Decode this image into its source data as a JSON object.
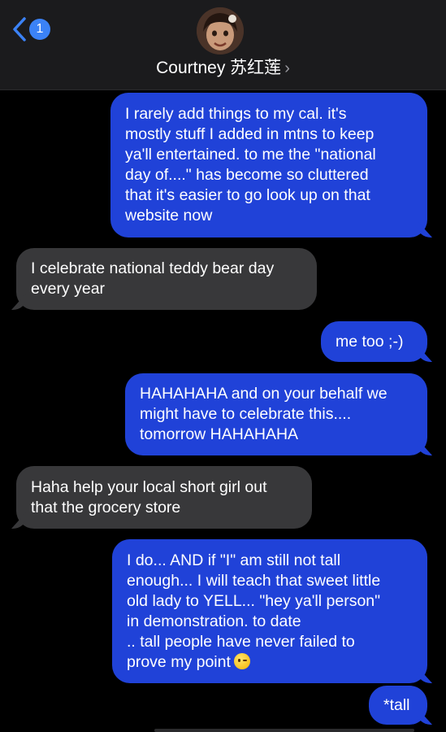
{
  "header": {
    "unread_count": "1",
    "contact_name": "Courtney 苏红莲",
    "contact_chevron": "›"
  },
  "messages": [
    {
      "from": "me",
      "text": "I rarely add things to my cal.  it's\nmostly stuff I added in mtns to keep\nya'll entertained.  to me the \"national\nday of....\" has become so cluttered\nthat it's easier to go look up on that\nwebsite now"
    },
    {
      "from": "them",
      "text": "I celebrate national teddy bear day\nevery year"
    },
    {
      "from": "me",
      "text": "me too ;-)"
    },
    {
      "from": "me",
      "text": "HAHAHAHA and on your behalf we\nmight have to celebrate this....\ntomorrow HAHAHAHA"
    },
    {
      "from": "them",
      "text": "Haha help your local short girl out\nthat the grocery store"
    },
    {
      "from": "me",
      "text": "I do... AND if \"I\" am still not tall\nenough... I will teach that sweet little\nold lady to YELL... \"hey ya'll person\"\nin demonstration.  to date\n.. tall people have never failed to\nprove my point",
      "emoji": "winking-face"
    },
    {
      "from": "me",
      "text": "*tall"
    }
  ],
  "colors": {
    "sent_bubble": "#2042d8",
    "received_bubble": "#38383a",
    "accent": "#3b82f6"
  }
}
